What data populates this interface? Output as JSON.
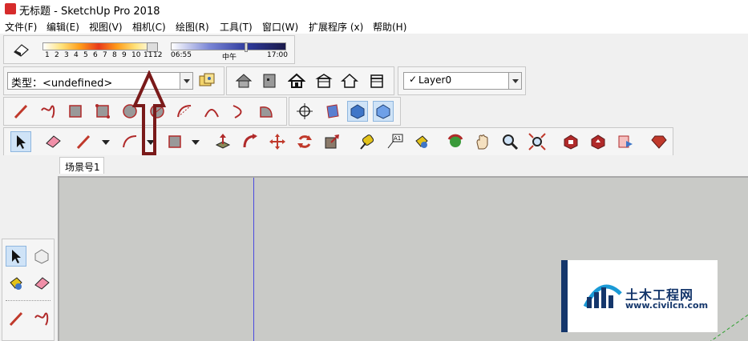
{
  "window": {
    "title": "无标题 - SketchUp Pro 2018"
  },
  "menu": [
    "文件(F)",
    "编辑(E)",
    "视图(V)",
    "相机(C)",
    "绘图(R)",
    "工具(T)",
    "窗口(W)",
    "扩展程序 (x)",
    "帮助(H)"
  ],
  "shadow": {
    "month_ticks": [
      "1",
      "2",
      "3",
      "4",
      "5",
      "6",
      "7",
      "8",
      "9",
      "10",
      "11",
      "12"
    ],
    "time_start": "06:55",
    "time_mid": "中午",
    "time_end": "17:00"
  },
  "entity_info": {
    "type_label": "类型：",
    "type_value": "<undefined>"
  },
  "layer": {
    "current": "Layer0",
    "checked": true
  },
  "scene": {
    "tab_label": "场景号1"
  },
  "watermark": {
    "brand": "土木工程网",
    "url": "www.civilcn.com"
  },
  "colors": {
    "toolbar": "#f0f0f0",
    "viewport": "#c9cac7",
    "annotation_arrow": "#7a1a1a",
    "axis_blue": "#4a4adf",
    "axis_green": "#2ca02c",
    "brand_blue": "#14366b"
  }
}
